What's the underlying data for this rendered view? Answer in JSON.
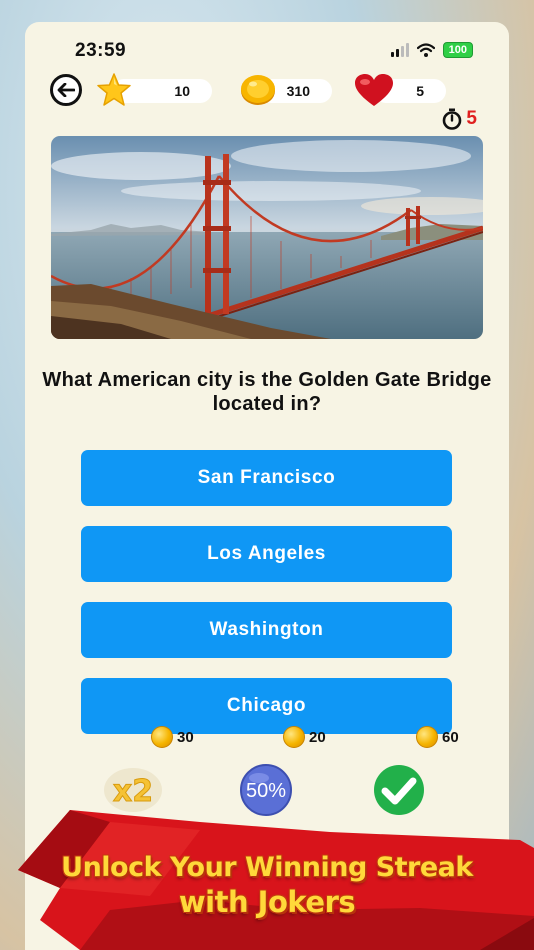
{
  "status": {
    "time": "23:59",
    "battery": "100"
  },
  "stats": {
    "stars": "10",
    "coins": "310",
    "lives": "5"
  },
  "timer": {
    "value": "5"
  },
  "question": {
    "text": "What American city is the Golden Gate Bridge located in?"
  },
  "answers": [
    {
      "label": "San Francisco"
    },
    {
      "label": "Los Angeles"
    },
    {
      "label": "Washington"
    },
    {
      "label": "Chicago"
    }
  ],
  "jokers": [
    {
      "icon": "x2",
      "cost": "30"
    },
    {
      "icon": "50%",
      "cost": "20"
    },
    {
      "icon": "check-icon",
      "cost": "60"
    }
  ],
  "banner": {
    "line1": "Unlock Your Winning Streak",
    "line2": "with Jokers"
  },
  "colors": {
    "answer_bg": "#0f97f5",
    "timer": "#e02020",
    "banner_ribbon": "#d8141b",
    "banner_text": "#ffd93a"
  }
}
